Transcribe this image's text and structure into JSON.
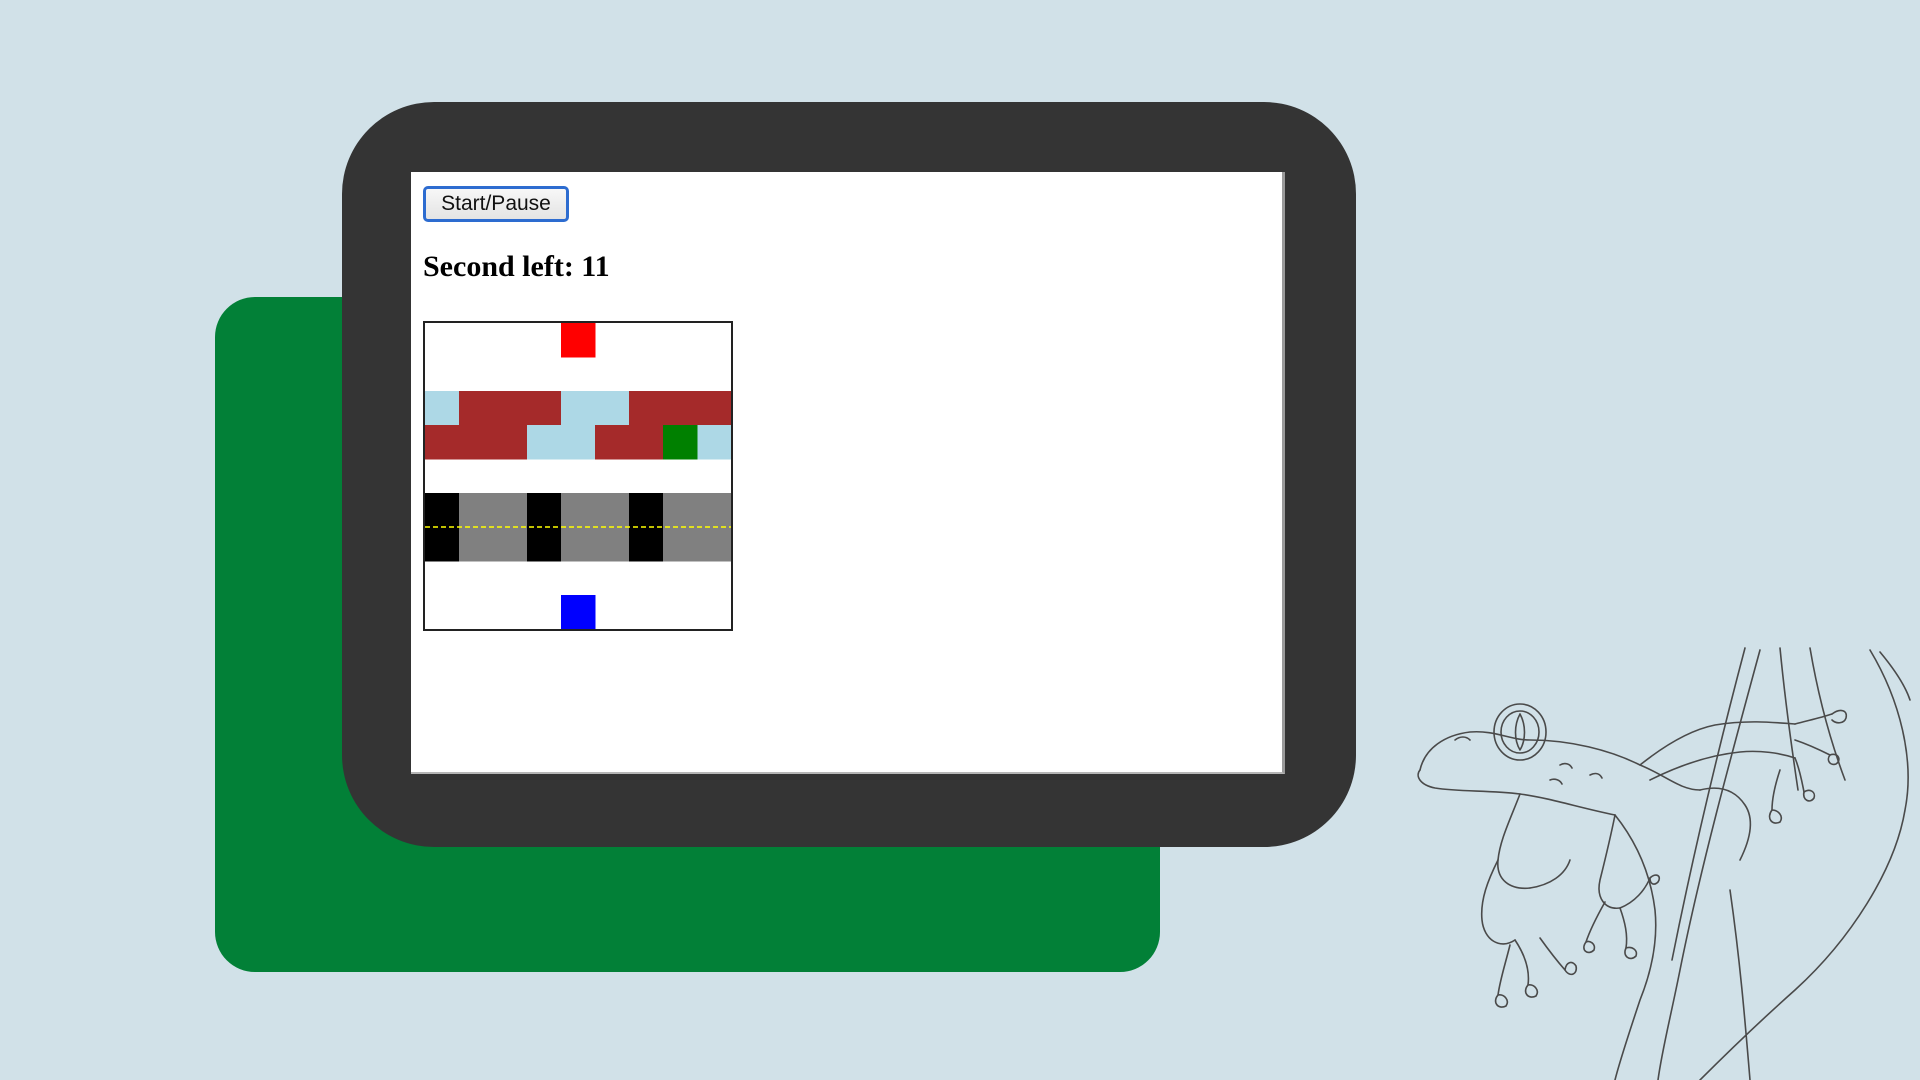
{
  "controls": {
    "start_pause_label": "Start/Pause"
  },
  "status": {
    "seconds_left_text": "Second left: 11"
  },
  "game": {
    "grid_columns": 9,
    "grid_rows": 9,
    "colors": {
      "background": "#d1e1e8",
      "card": "#028037",
      "tablet_frame": "#343434",
      "water": "#add8e6",
      "log": "#a52a2a",
      "road": "#808080",
      "car": "#000000",
      "lane_line": "#ffff00",
      "goal": "#ff0000",
      "player_frog": "#0000ff",
      "green_frog": "#008000"
    },
    "goal_cell": {
      "col": 4,
      "row": 0
    },
    "player_cell": {
      "col": 4,
      "row": 8
    },
    "green_frog_cell": {
      "col": 7,
      "row": 3
    },
    "river_rows": [
      {
        "row": 2,
        "cells": [
          "water",
          "log",
          "log",
          "log",
          "water",
          "water",
          "log",
          "log",
          "log"
        ]
      },
      {
        "row": 3,
        "cells": [
          "log",
          "log",
          "log",
          "water",
          "water",
          "log",
          "log",
          "log",
          "water"
        ]
      }
    ],
    "road_rows": [
      {
        "row": 5,
        "cells": [
          "car",
          "road",
          "road",
          "car",
          "road",
          "road",
          "car",
          "road",
          "road"
        ]
      },
      {
        "row": 6,
        "cells": [
          "car",
          "road",
          "road",
          "car",
          "road",
          "road",
          "car",
          "road",
          "road"
        ]
      }
    ]
  }
}
